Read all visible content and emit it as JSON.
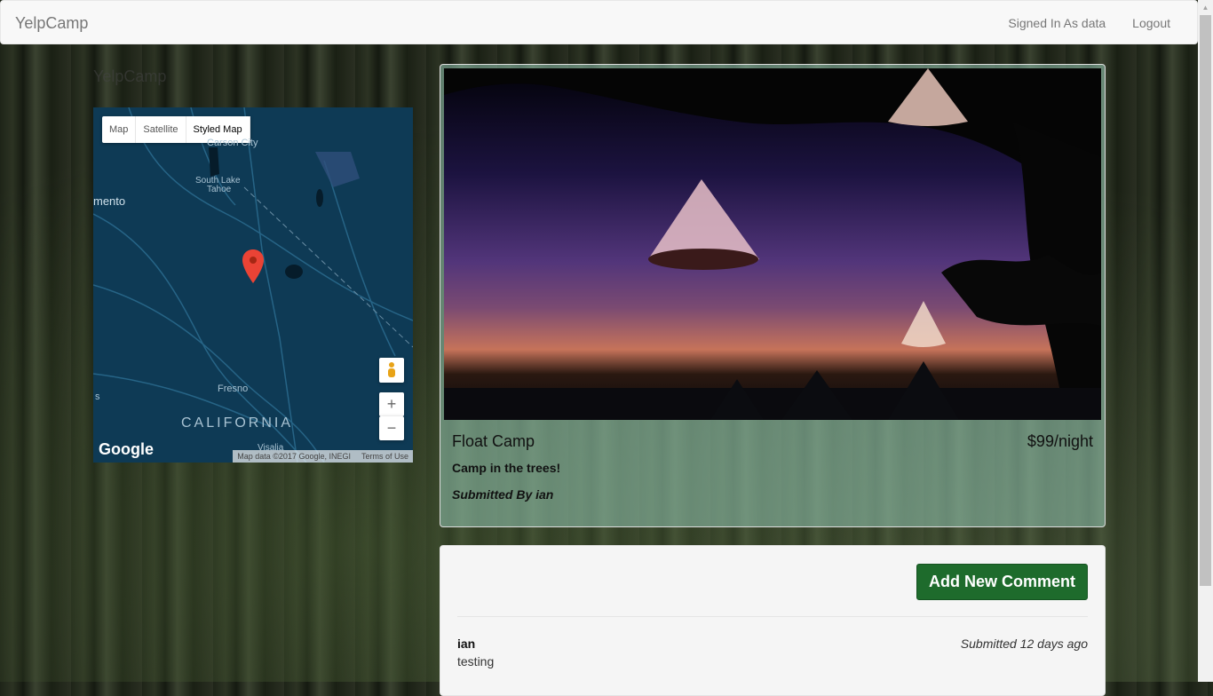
{
  "navbar": {
    "brand": "YelpCamp",
    "signed_in": "Signed In As data",
    "logout": "Logout"
  },
  "sidebar": {
    "brand": "YelpCamp"
  },
  "map": {
    "types": [
      "Map",
      "Satellite",
      "Styled Map"
    ],
    "labels": {
      "carson_city": "Carson City",
      "south_lake_tahoe_1": "South Lake",
      "south_lake_tahoe_2": "Tahoe",
      "mento": "mento",
      "fresno": "Fresno",
      "california": "CALIFORNIA",
      "visalia": "Visalia",
      "s": "s"
    },
    "zoom_in": "+",
    "zoom_out": "−",
    "google": "Google",
    "map_data": "Map data ©2017 Google, INEGI",
    "terms": "Terms of Use"
  },
  "campground": {
    "name": "Float Camp",
    "price": "$99/night",
    "description": "Camp in the trees!",
    "submitted_by": "Submitted By ian"
  },
  "comments": {
    "add_button": "Add New Comment",
    "items": [
      {
        "author": "ian",
        "time": "Submitted 12 days ago",
        "text": "testing"
      }
    ]
  }
}
